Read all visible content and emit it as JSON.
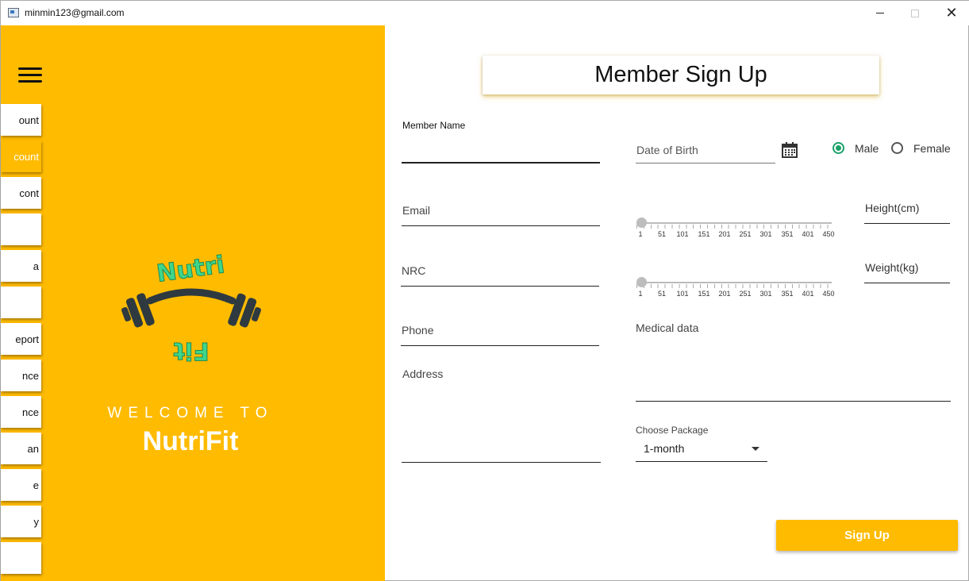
{
  "window": {
    "title": "minmin123@gmail.com",
    "close_glyph": "✕"
  },
  "sidebar": {
    "items": [
      {
        "label": "ount",
        "active": false
      },
      {
        "label": "count",
        "active": true
      },
      {
        "label": "cont",
        "active": false
      },
      {
        "label": "",
        "active": false
      },
      {
        "label": "a",
        "active": false
      },
      {
        "label": "",
        "active": false
      },
      {
        "label": "eport",
        "active": false
      },
      {
        "label": "nce",
        "active": false
      },
      {
        "label": "nce",
        "active": false
      },
      {
        "label": "an",
        "active": false
      },
      {
        "label": "e",
        "active": false
      },
      {
        "label": "y",
        "active": false
      },
      {
        "label": "",
        "active": false
      }
    ]
  },
  "welcome": {
    "line": "WELCOME TO",
    "brand": "NutriFit",
    "logo_top_text": "Nutri",
    "logo_bottom_text": "Fit"
  },
  "form": {
    "title": "Member Sign Up",
    "member_name_label": "Member Name",
    "member_name_value": "",
    "dob_placeholder": "Date of Birth",
    "gender_options": [
      {
        "label": "Male",
        "checked": true
      },
      {
        "label": "Female",
        "checked": false
      }
    ],
    "email_placeholder": "Email",
    "nrc_placeholder": "NRC",
    "phone_placeholder": "Phone",
    "address_placeholder": "Address",
    "height_placeholder": "Height(cm)",
    "weight_placeholder": "Weight(kg)",
    "medical_placeholder": "Medical data",
    "package_label": "Choose Package",
    "package_value": "1-month",
    "signup_label": "Sign Up"
  },
  "sliders": {
    "height": {
      "value": 1,
      "min": 1,
      "max": 450
    },
    "weight": {
      "value": 1,
      "min": 1,
      "max": 450
    },
    "tick_labels": [
      "1",
      "51",
      "101",
      "151",
      "201",
      "251",
      "301",
      "351",
      "401",
      "450"
    ]
  },
  "colors": {
    "accent": "#ffbb00",
    "radio_checked": "#1aa16a",
    "logo_dark": "#2e3a3f",
    "logo_text": "#3fd68a"
  }
}
